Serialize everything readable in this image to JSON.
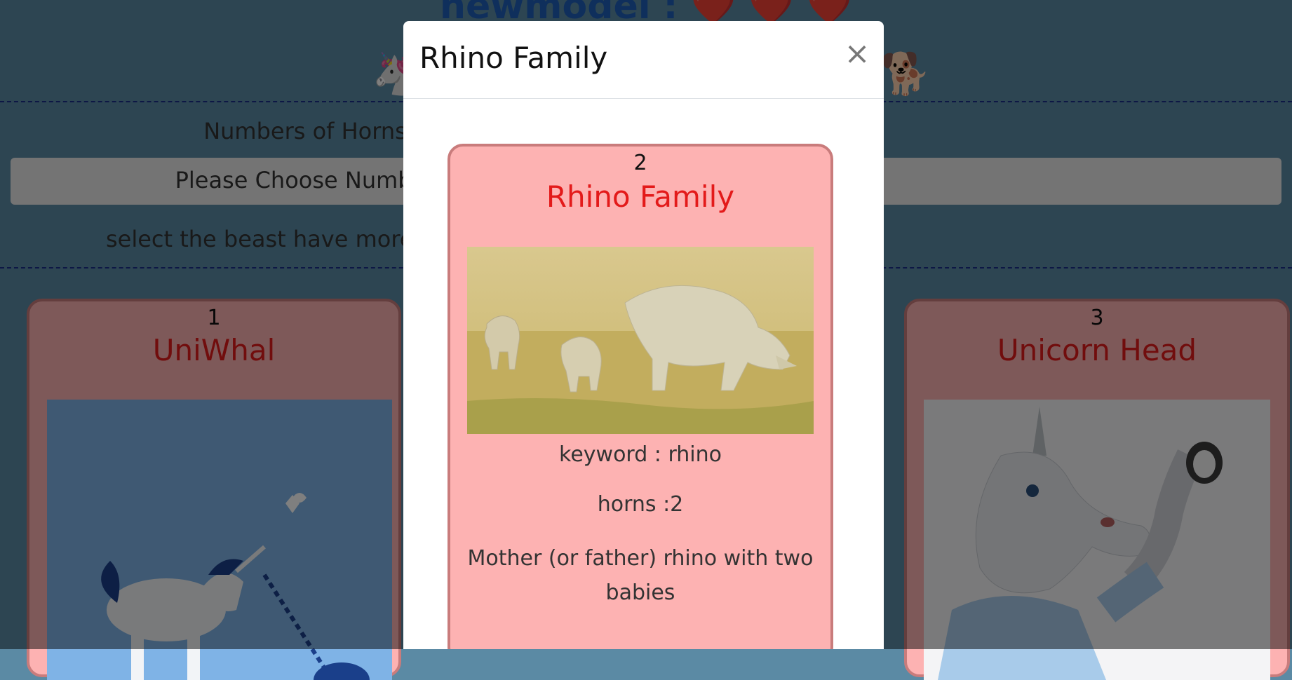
{
  "page": {
    "title_text": "newmodel :",
    "title_hearts": "❤️ ❤️ ❤️",
    "emoji_left": "🦄",
    "emoji_right": "🐕",
    "numbers_label": "Numbers of Horns",
    "select_placeholder": "Please Choose Number",
    "beast_label": "select the beast have more horns"
  },
  "cards": [
    {
      "num": "1",
      "title": "UniWhal",
      "image": "uniwhal-illustration"
    },
    {
      "num": "3",
      "title": "Unicorn Head",
      "image": "unicorn-head-photo"
    }
  ],
  "modal": {
    "title": "Rhino Family",
    "close_label": "×",
    "card": {
      "num": "2",
      "title": "Rhino Family",
      "image": "rhino-family-photo",
      "keyword": "keyword : rhino",
      "horns": "horns :2",
      "description": "Mother (or father) rhino with two babies"
    }
  },
  "colors": {
    "card_bg": "#fdb2b2",
    "card_border": "#c97c7c",
    "card_title": "#e31a1a",
    "page_bg": "#5b8aa4"
  }
}
